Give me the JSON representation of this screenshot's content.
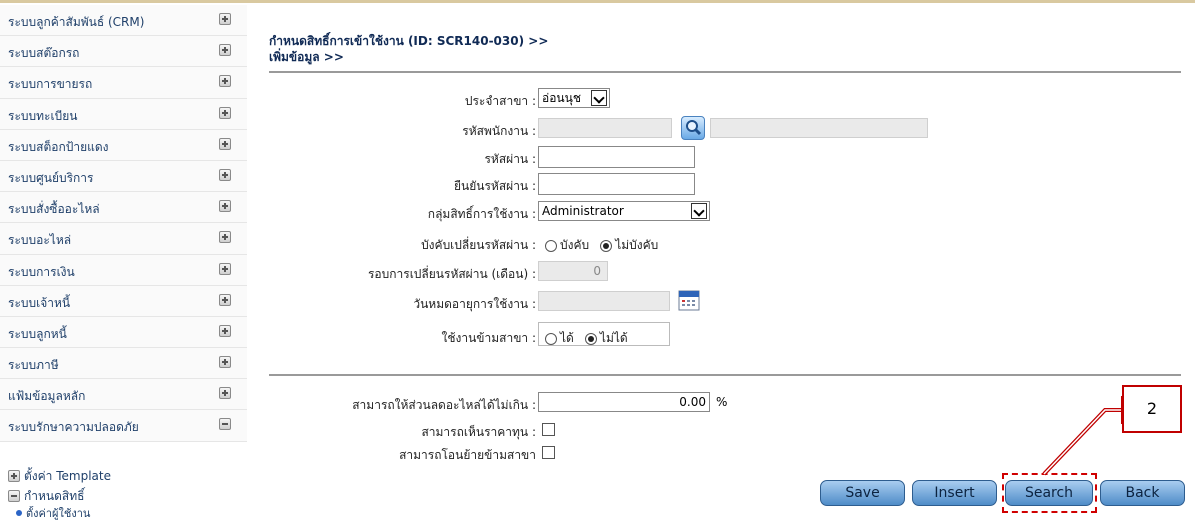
{
  "sidebar": {
    "items": [
      {
        "label": "ระบบลูกค้าสัมพันธ์ (CRM)",
        "state": "expand"
      },
      {
        "label": "ระบบสต๊อกรถ",
        "state": "expand"
      },
      {
        "label": "ระบบการขายรถ",
        "state": "expand"
      },
      {
        "label": "ระบบทะเบียน",
        "state": "expand"
      },
      {
        "label": "ระบบสต็อกป้ายแดง",
        "state": "expand"
      },
      {
        "label": "ระบบศูนย์บริการ",
        "state": "expand"
      },
      {
        "label": "ระบบสั่งซื้ออะไหล่",
        "state": "expand"
      },
      {
        "label": "ระบบอะไหล่",
        "state": "expand"
      },
      {
        "label": "ระบบการเงิน",
        "state": "expand"
      },
      {
        "label": "ระบบเจ้าหนี้",
        "state": "expand"
      },
      {
        "label": "ระบบลูกหนี้",
        "state": "expand"
      },
      {
        "label": "ระบบภาษี",
        "state": "expand"
      },
      {
        "label": "แฟ้มข้อมูลหลัก",
        "state": "expand"
      },
      {
        "label": "ระบบรักษาความปลอดภัย",
        "state": "collapse"
      }
    ],
    "subtree": {
      "template": "ตั้งค่า Template",
      "rights": "กำหนดสิทธิ์",
      "leaf": "ตั้งค่าผู้ใช้งาน"
    }
  },
  "header": {
    "title_line1": "กำหนดสิทธิ์การเข้าใช้งาน (ID: SCR140-030) >>",
    "title_line2": "เพิ่มข้อมูล >>"
  },
  "form": {
    "branch_label": "ประจำสาขา :",
    "branch_value": "อ่อนนุช",
    "employee_label": "รหัสพนักงาน :",
    "password_label": "รหัสผ่าน :",
    "confirm_label": "ยืนยันรหัสผ่าน :",
    "group_label": "กลุ่มสิทธิ์การใช้งาน :",
    "group_value": "Administrator",
    "force_label": "บังคับเปลี่ยนรหัสผ่าน :",
    "force_opt_yes": "บังคับ",
    "force_opt_no": "ไม่บังคับ",
    "cycle_label": "รอบการเปลี่ยนรหัสผ่าน (เดือน) :",
    "cycle_value": "0",
    "expire_label": "วันหมดอายุการใช้งาน :",
    "cross_label": "ใช้งานข้ามสาขา :",
    "cross_opt_yes": "ได้",
    "cross_opt_no": "ไม่ได้",
    "discount_label": "สามารถให้ส่วนลดอะไหล่ได้ไม่เกิน :",
    "discount_value": "0.00",
    "discount_unit": "%",
    "cost_label": "สามารถเห็นราคาทุน :",
    "transfer_label": "สามารถโอนย้ายข้ามสาขา"
  },
  "buttons": {
    "save": "Save",
    "insert": "Insert",
    "search": "Search",
    "back": "Back"
  },
  "annotation": {
    "number": "2",
    "color": "#c00000"
  }
}
